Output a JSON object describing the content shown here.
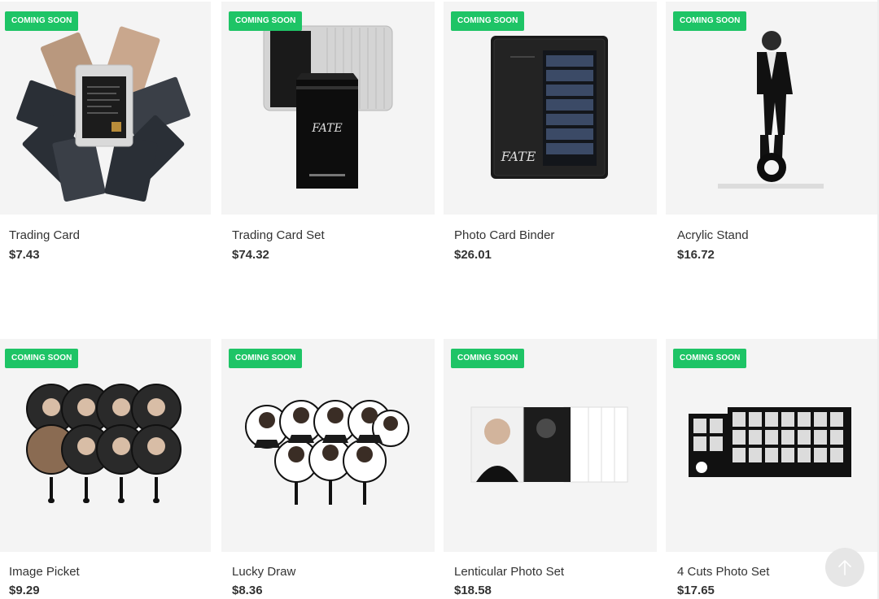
{
  "colors": {
    "badge": "#1ec466",
    "thumb_bg": "#f4f4f4"
  },
  "products": [
    {
      "name": "Trading Card",
      "price": "$7.43",
      "badge": "COMING SOON"
    },
    {
      "name": "Trading Card Set",
      "price": "$74.32",
      "badge": "COMING SOON"
    },
    {
      "name": "Photo Card Binder",
      "price": "$26.01",
      "badge": "COMING SOON"
    },
    {
      "name": "Acrylic Stand",
      "price": "$16.72",
      "badge": "COMING SOON"
    },
    {
      "name": "Image Picket",
      "price": "$9.29",
      "badge": "COMING SOON"
    },
    {
      "name": "Lucky Draw",
      "price": "$8.36",
      "badge": "COMING SOON"
    },
    {
      "name": "Lenticular Photo Set",
      "price": "$18.58",
      "badge": "COMING SOON"
    },
    {
      "name": "4 Cuts Photo Set",
      "price": "$17.65",
      "badge": "COMING SOON"
    }
  ],
  "scroll_top": {
    "icon": "arrow-up-icon"
  }
}
